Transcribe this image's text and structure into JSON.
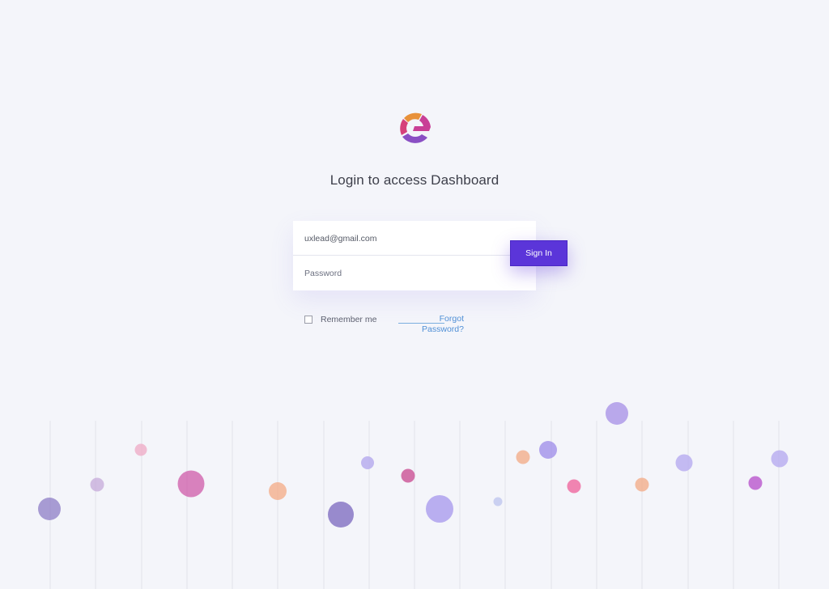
{
  "page": {
    "title": "Login to access Dashboard"
  },
  "logo": {
    "icon": "brand-logo-icon",
    "colors": [
      "#e8913a",
      "#d6407a",
      "#8a4fc4",
      "#5b35d9"
    ]
  },
  "form": {
    "email_value": "uxlead@gmail.com",
    "password_placeholder": "Password",
    "signin_label": "Sign In",
    "remember_label": "Remember me",
    "remember_checked": false,
    "forgot_label": "Forgot Password?"
  },
  "colors": {
    "accent": "#5b35d9",
    "link": "#4f8fd6",
    "background": "#f4f5fa"
  }
}
